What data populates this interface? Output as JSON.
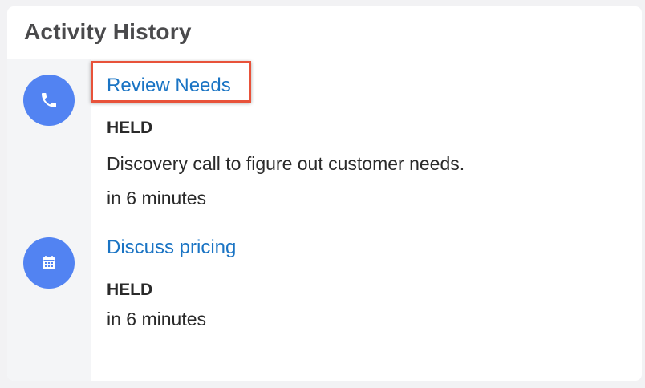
{
  "card": {
    "title": "Activity History"
  },
  "activities": [
    {
      "icon": "phone-icon",
      "title": "Review Needs",
      "status": "HELD",
      "description": "Discovery call to figure out customer needs.",
      "when": "in 6 minutes"
    },
    {
      "icon": "calendar-icon",
      "title": "Discuss pricing",
      "status": "HELD",
      "when": "in 6 minutes"
    }
  ],
  "colors": {
    "icon_background": "#5283f2",
    "link": "#1a74c4",
    "highlight_border": "#e8523a"
  }
}
